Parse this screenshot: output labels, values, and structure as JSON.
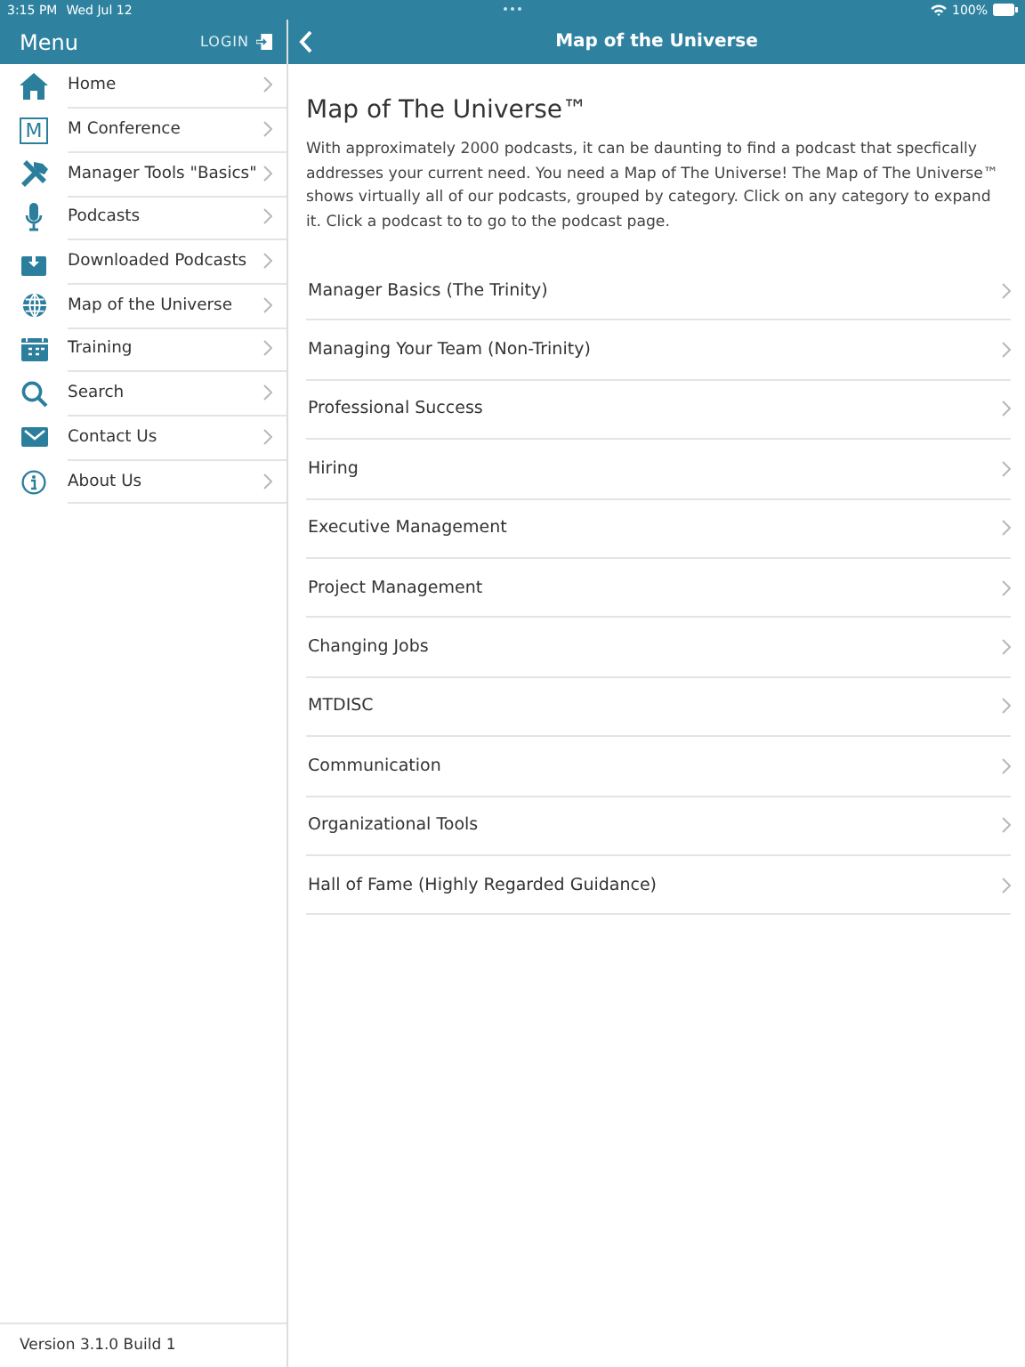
{
  "status_bar": {
    "time": "3:15 PM",
    "date": "Wed Jul 12",
    "battery": "100%"
  },
  "sidebar": {
    "title": "Menu",
    "login": "LOGIN",
    "items": [
      {
        "label": "Home",
        "kind": "home"
      },
      {
        "label": "M Conference",
        "kind": "m",
        "icon_text": "M"
      },
      {
        "label": "Manager Tools \"Basics\"",
        "kind": "tools"
      },
      {
        "label": "Podcasts",
        "kind": "mic"
      },
      {
        "label": "Downloaded Podcasts",
        "kind": "download"
      },
      {
        "label": "Map of the Universe",
        "kind": "globe"
      },
      {
        "label": "Training",
        "kind": "calendar"
      },
      {
        "label": "Search",
        "kind": "search"
      },
      {
        "label": "Contact Us",
        "kind": "mail"
      },
      {
        "label": "About Us",
        "kind": "info"
      }
    ],
    "version": "Version 3.1.0 Build 1"
  },
  "header": {
    "title": "Map of the Universe"
  },
  "content": {
    "heading": "Map of The Universe™",
    "intro": "With approximately 2000 podcasts, it can be daunting to find a podcast that specfically addresses your current need. You need a Map of The Universe! The Map of The Universe™ shows virtually all of our podcasts, grouped by category. Click on any category to expand it. Click a podcast to to go to the podcast page.",
    "categories": [
      "Manager Basics (The Trinity)",
      "Managing Your Team (Non-Trinity)",
      "Professional Success",
      "Hiring",
      "Executive Management",
      "Project Management",
      "Changing Jobs",
      "MTDISC",
      "Communication",
      "Organizational Tools",
      "Hall of Fame (Highly Regarded Guidance)"
    ]
  }
}
